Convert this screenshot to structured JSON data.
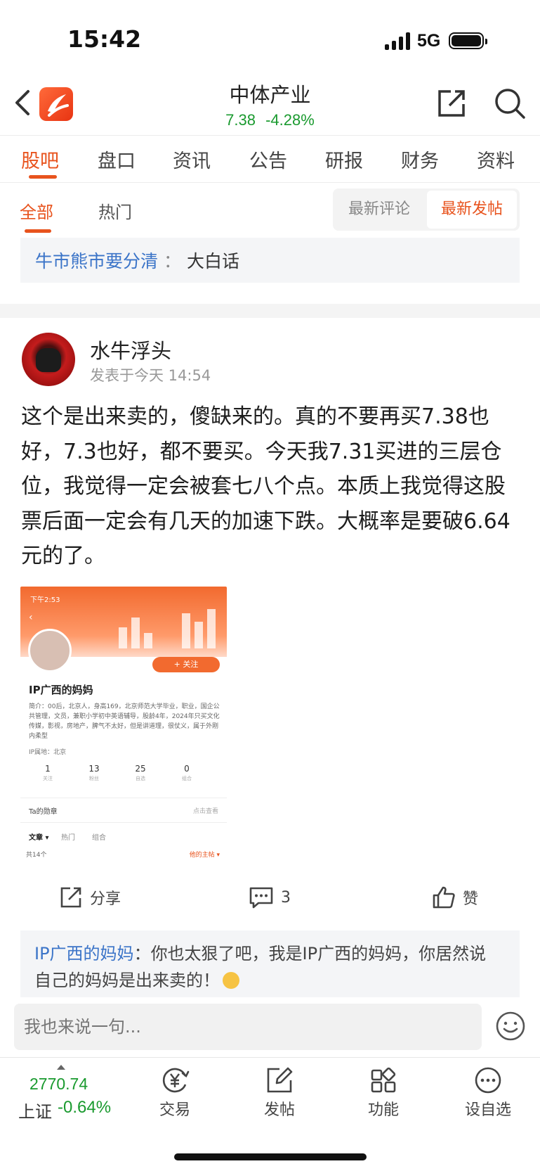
{
  "status_bar": {
    "time": "15:42",
    "network": "5G"
  },
  "header": {
    "stock_name": "中体产业",
    "price": "7.38",
    "change": "-4.28%",
    "icons": [
      "back-icon",
      "app-logo",
      "share-icon",
      "search-icon"
    ]
  },
  "main_tabs": [
    "股吧",
    "盘口",
    "资讯",
    "公告",
    "研报",
    "财务",
    "资料"
  ],
  "sub_tabs": [
    "全部",
    "热门"
  ],
  "sort": {
    "latest_comment": "最新评论",
    "latest_post": "最新发帖"
  },
  "banner": {
    "link": "牛市熊市要分清",
    "sep": "：",
    "tail": "大白话"
  },
  "post": {
    "author": "水牛浮头",
    "time": "发表于今天 14:54",
    "body": "这个是出来卖的，傻缺来的。真的不要再买7.38也好，7.3也好，都不要买。今天我7.31买进的三层仓位，我觉得一定会被套七八个点。本质上我觉得这股票后面一定会有几天的加速下跌。大概率是要破6.64元的了。",
    "image": {
      "time": "下午2:53",
      "follow": "+ 关注",
      "name": "IP广西的妈妈",
      "bio": "简介：00后，北京人，身高169，北京师范大学毕业，职业，国企公共管理，文员，兼职小学初中英语辅导，股龄4年，2024年只买文化传媒，影视，房地产，脾气不太好，但是讲道理，很仗义，属于外刚内柔型",
      "ip": "IP属地：北京",
      "stats": [
        {
          "n": "1",
          "l": "关注"
        },
        {
          "n": "13",
          "l": "粉丝"
        },
        {
          "n": "25",
          "l": "自选"
        },
        {
          "n": "0",
          "l": "组合"
        }
      ],
      "medal": "Ta的勋章",
      "medal_link": "点击查看",
      "tabs": [
        "文章 ▾",
        "热门",
        "组合"
      ],
      "count": "共14个",
      "more": "他的主帖 ▾"
    },
    "actions": {
      "share": "分享",
      "comments": "3",
      "like": "赞"
    }
  },
  "comment": {
    "author": "IP广西的妈妈",
    "sep": "：",
    "text": "你也太狠了吧，我是IP广西的妈妈，你居然说自己的妈妈是出来卖的！"
  },
  "input": {
    "placeholder": "我也来说一句..."
  },
  "bottom_bar": {
    "index_value": "2770.74",
    "index_name": "上证",
    "index_change": "-0.64%",
    "items": [
      "交易",
      "发帖",
      "功能",
      "设自选"
    ]
  },
  "colors": {
    "accent": "#e8531d",
    "down": "#1a9a2f",
    "link": "#3b74c8"
  }
}
